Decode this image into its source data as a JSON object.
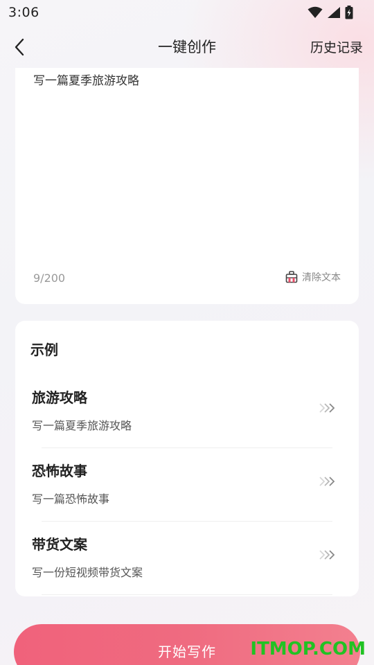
{
  "status_bar": {
    "time": "3:06",
    "icons": [
      "wifi-icon",
      "signal-icon",
      "battery-charging-icon"
    ]
  },
  "nav": {
    "title": "一键创作",
    "history_label": "历史记录",
    "back_icon": "chevron-left-icon"
  },
  "input": {
    "value": "写一篇夏季旅游攻略",
    "char_count": "9/200",
    "clear_label": "清除文本",
    "clear_icon": "clear-bag-icon"
  },
  "examples": {
    "title": "示例",
    "items": [
      {
        "title": "旅游攻略",
        "desc": "写一篇夏季旅游攻略"
      },
      {
        "title": "恐怖故事",
        "desc": "写一篇恐怖故事"
      },
      {
        "title": "带货文案",
        "desc": "写一份短视频带货文案"
      }
    ]
  },
  "start_button": {
    "label": "开始写作"
  },
  "watermark": {
    "text": "ITMOP.COM"
  },
  "colors": {
    "accent": "#f0627b",
    "watermark": "#21c223",
    "card": "#ffffff"
  }
}
